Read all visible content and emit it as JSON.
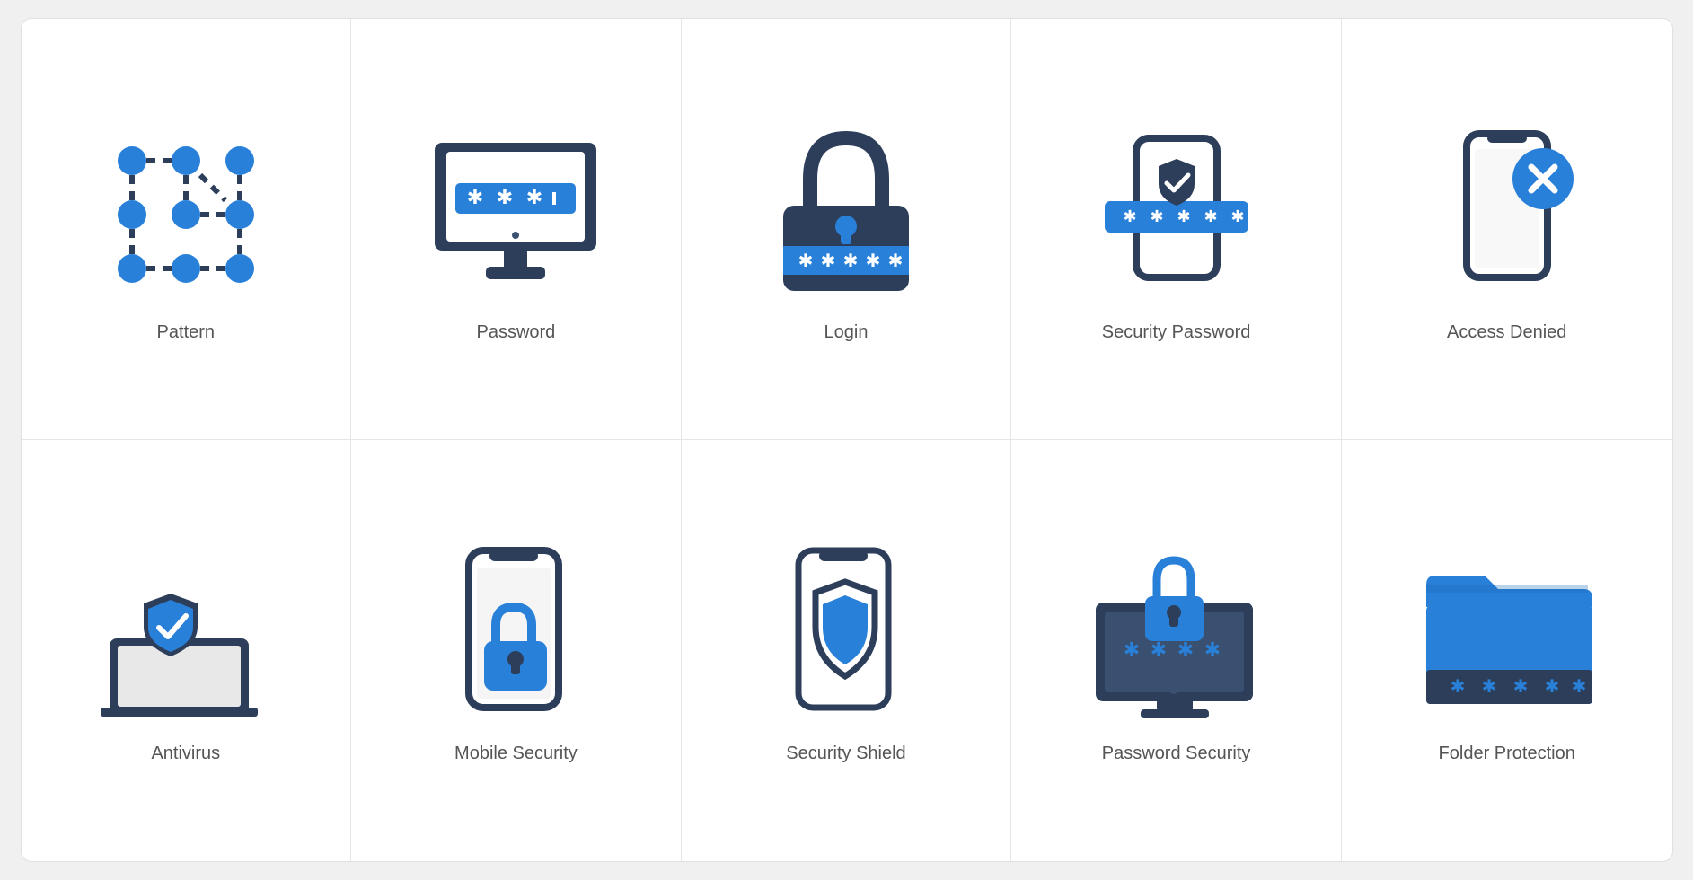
{
  "cells": [
    {
      "id": "pattern",
      "label": "Pattern"
    },
    {
      "id": "password",
      "label": "Password"
    },
    {
      "id": "login",
      "label": "Login"
    },
    {
      "id": "security-password",
      "label": "Security Password"
    },
    {
      "id": "access-denied",
      "label": "Access Denied"
    },
    {
      "id": "antivirus",
      "label": "Antivirus"
    },
    {
      "id": "mobile-security",
      "label": "Mobile Security"
    },
    {
      "id": "security-shield",
      "label": "Security Shield"
    },
    {
      "id": "password-security",
      "label": "Password Security"
    },
    {
      "id": "folder-protection",
      "label": "Folder Protection"
    }
  ],
  "colors": {
    "dark": "#2c3e5a",
    "blue": "#2980d9",
    "label": "#555555",
    "border": "#e5e5e5",
    "bg": "#ffffff"
  }
}
